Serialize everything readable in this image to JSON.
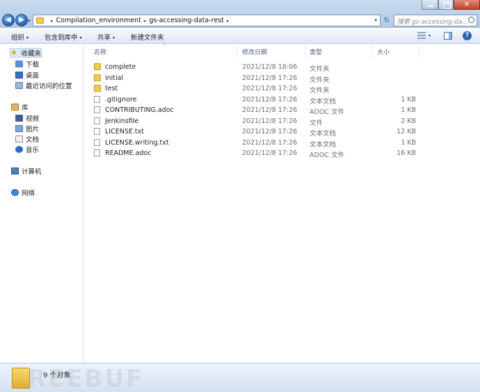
{
  "window": {
    "close_glyph": "✕"
  },
  "address_bar": {
    "crumbs": [
      "Compilation_environment",
      "gs-accessing-data-rest"
    ],
    "separator": "▸",
    "dropdown_glyph": "▾",
    "refresh_glyph": "↻"
  },
  "search": {
    "placeholder": "搜索 gs-accessing-da..."
  },
  "toolbar": {
    "organize": "组织",
    "include_in_library": "包含到库中",
    "share": "共享",
    "new_folder": "新建文件夹",
    "caret": "▾",
    "help_glyph": "?"
  },
  "sidebar": {
    "favorites": "收藏夹",
    "downloads": "下载",
    "desktop": "桌面",
    "recent": "最近访问的位置",
    "libraries": "库",
    "videos": "视频",
    "pictures": "图片",
    "documents": "文档",
    "music": "音乐",
    "computer": "计算机",
    "network": "网络",
    "star_glyph": "★"
  },
  "columns": {
    "name": "名称",
    "date": "修改日期",
    "type": "类型",
    "size": "大小",
    "sort_glyph": "^"
  },
  "files": [
    {
      "name": "complete",
      "date": "2021/12/8 18:06",
      "type": "文件夹",
      "size": "",
      "kind": "folder"
    },
    {
      "name": "initial",
      "date": "2021/12/8 17:26",
      "type": "文件夹",
      "size": "",
      "kind": "folder"
    },
    {
      "name": "test",
      "date": "2021/12/8 17:26",
      "type": "文件夹",
      "size": "",
      "kind": "folder"
    },
    {
      "name": ".gitignore",
      "date": "2021/12/8 17:26",
      "type": "文本文档",
      "size": "1 KB",
      "kind": "file"
    },
    {
      "name": "CONTRIBUTING.adoc",
      "date": "2021/12/8 17:26",
      "type": "ADOC 文件",
      "size": "1 KB",
      "kind": "file"
    },
    {
      "name": "Jenkinsfile",
      "date": "2021/12/8 17:26",
      "type": "文件",
      "size": "2 KB",
      "kind": "file"
    },
    {
      "name": "LICENSE.txt",
      "date": "2021/12/8 17:26",
      "type": "文本文档",
      "size": "12 KB",
      "kind": "file"
    },
    {
      "name": "LICENSE.writing.txt",
      "date": "2021/12/8 17:26",
      "type": "文本文档",
      "size": "1 KB",
      "kind": "file"
    },
    {
      "name": "README.adoc",
      "date": "2021/12/8 17:26",
      "type": "ADOC 文件",
      "size": "16 KB",
      "kind": "file"
    }
  ],
  "status": {
    "item_count": "9 个对象",
    "watermark": "REEBUF"
  }
}
